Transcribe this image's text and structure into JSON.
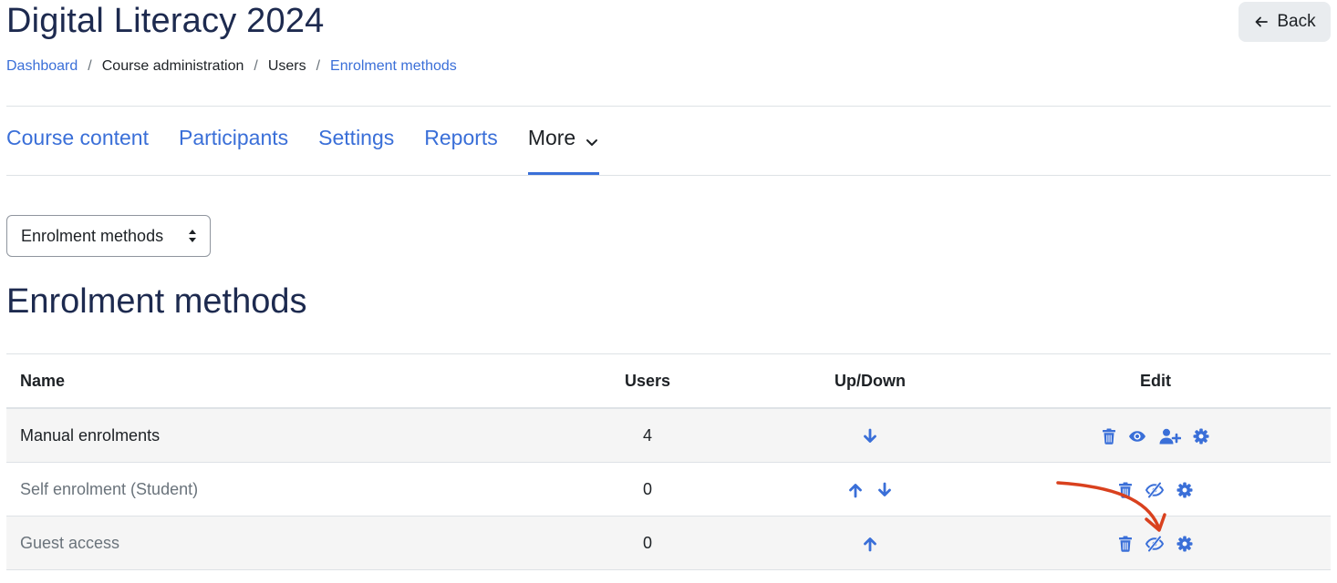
{
  "header": {
    "title": "Digital Literacy 2024",
    "back_label": "Back"
  },
  "breadcrumb": [
    {
      "label": "Dashboard",
      "link": true
    },
    {
      "label": "Course administration",
      "link": false
    },
    {
      "label": "Users",
      "link": false
    },
    {
      "label": "Enrolment methods",
      "link": true
    }
  ],
  "nav": {
    "items": [
      "Course content",
      "Participants",
      "Settings",
      "Reports"
    ],
    "more_label": "More"
  },
  "select": {
    "value": "Enrolment methods"
  },
  "section": {
    "heading": "Enrolment methods"
  },
  "table": {
    "headers": {
      "name": "Name",
      "users": "Users",
      "updown": "Up/Down",
      "edit": "Edit"
    },
    "rows": [
      {
        "name": "Manual enrolments",
        "users": "4",
        "moves": [
          "down"
        ],
        "actions": [
          "delete",
          "disable",
          "enrol-users",
          "settings"
        ],
        "enabled": true
      },
      {
        "name": "Self enrolment (Student)",
        "users": "0",
        "moves": [
          "up",
          "down"
        ],
        "actions": [
          "delete",
          "enable",
          "settings"
        ],
        "enabled": false
      },
      {
        "name": "Guest access",
        "users": "0",
        "moves": [
          "up"
        ],
        "actions": [
          "delete",
          "enable",
          "settings"
        ],
        "enabled": false
      }
    ]
  },
  "colors": {
    "accent": "#3a6fd8",
    "heading": "#1d2a4f",
    "annotation_arrow": "#d9411e"
  },
  "icons": {
    "delete": "trash-icon",
    "disable": "eye-icon",
    "enable": "eye-slash-icon",
    "enrol-users": "user-plus-icon",
    "settings": "gear-icon",
    "up": "arrow-up-icon",
    "down": "arrow-down-icon"
  }
}
